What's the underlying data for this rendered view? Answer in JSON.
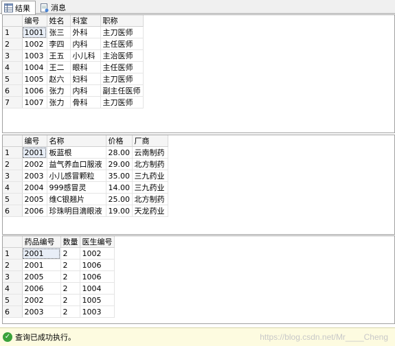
{
  "tabs": {
    "results": "结果",
    "messages": "消息"
  },
  "grid1": {
    "headers": [
      "编号",
      "姓名",
      "科室",
      "职称"
    ],
    "rows": [
      [
        "1",
        "1001",
        "张三",
        "外科",
        "主刀医师"
      ],
      [
        "2",
        "1002",
        "李四",
        "内科",
        "主任医师"
      ],
      [
        "3",
        "1003",
        "王五",
        "小儿科",
        "主治医师"
      ],
      [
        "4",
        "1004",
        "王二",
        "眼科",
        "主任医师"
      ],
      [
        "5",
        "1005",
        "赵六",
        "妇科",
        "主刀医师"
      ],
      [
        "6",
        "1006",
        "张力",
        "内科",
        "副主任医师"
      ],
      [
        "7",
        "1007",
        "张力",
        "骨科",
        "主刀医师"
      ]
    ]
  },
  "grid2": {
    "headers": [
      "编号",
      "名称",
      "价格",
      "厂商"
    ],
    "rows": [
      [
        "1",
        "2001",
        "板蓝根",
        "28.00",
        "云南制药"
      ],
      [
        "2",
        "2002",
        "益气养血口服液",
        "29.00",
        "北方制药"
      ],
      [
        "3",
        "2003",
        "小儿感冒颗粒",
        "35.00",
        "三九药业"
      ],
      [
        "4",
        "2004",
        "999感冒灵",
        "14.00",
        "三九药业"
      ],
      [
        "5",
        "2005",
        "维C银翘片",
        "25.00",
        "北方制药"
      ],
      [
        "6",
        "2006",
        "珍珠明目滴眼液",
        "19.00",
        "天龙药业"
      ]
    ]
  },
  "grid3": {
    "headers": [
      "药品编号",
      "数量",
      "医生编号"
    ],
    "rows": [
      [
        "1",
        "2001",
        "2",
        "1002"
      ],
      [
        "2",
        "2001",
        "2",
        "1006"
      ],
      [
        "3",
        "2005",
        "2",
        "1006"
      ],
      [
        "4",
        "2006",
        "2",
        "1004"
      ],
      [
        "5",
        "2002",
        "2",
        "1005"
      ],
      [
        "6",
        "2003",
        "2",
        "1003"
      ]
    ]
  },
  "status": {
    "text": "查询已成功执行。",
    "watermark": "https://blog.csdn.net/Mr____Cheng"
  }
}
